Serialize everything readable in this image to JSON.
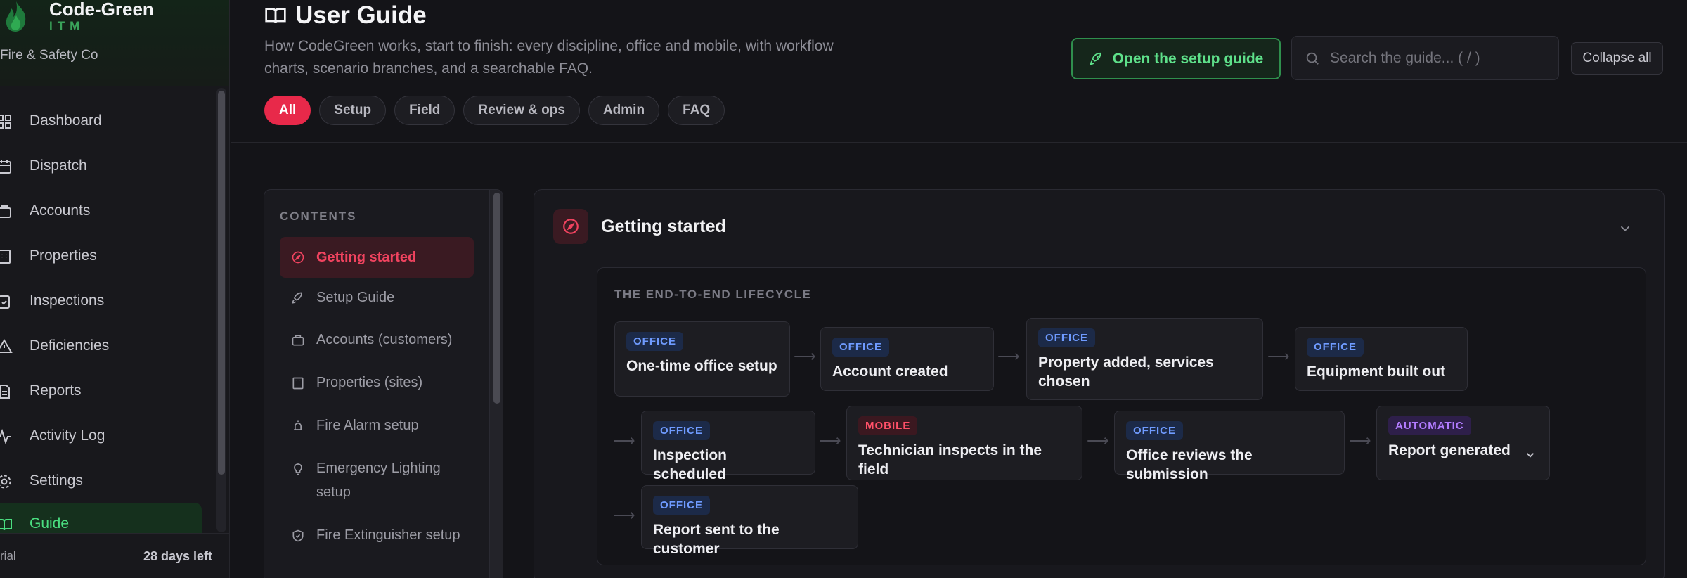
{
  "brand": {
    "name": "Code-Green",
    "sub": "ITM",
    "org": "Fire & Safety Co"
  },
  "nav": [
    {
      "label": "Dashboard",
      "icon": "grid-icon"
    },
    {
      "label": "Dispatch",
      "icon": "calendar-icon"
    },
    {
      "label": "Accounts",
      "icon": "briefcase-icon"
    },
    {
      "label": "Properties",
      "icon": "building-icon"
    },
    {
      "label": "Inspections",
      "icon": "clipboard-check-icon"
    },
    {
      "label": "Deficiencies",
      "icon": "warning-icon"
    },
    {
      "label": "Reports",
      "icon": "document-icon"
    },
    {
      "label": "Activity Log",
      "icon": "pulse-icon"
    },
    {
      "label": "Settings",
      "icon": "gear-icon"
    },
    {
      "label": "Guide",
      "icon": "book-icon",
      "active": true
    }
  ],
  "sidebar_footer": {
    "trial": "rial",
    "days_left": "28 days left"
  },
  "header": {
    "title": "User Guide",
    "subtitle": "How CodeGreen works, start to finish: every discipline, office and mobile, with workflow charts, scenario branches, and a searchable FAQ.",
    "setup_button": "Open the setup guide",
    "search_placeholder": "Search the guide...  ( / )",
    "collapse_button": "Collapse all",
    "filters": [
      "All",
      "Setup",
      "Field",
      "Review & ops",
      "Admin",
      "FAQ"
    ],
    "active_filter": "All"
  },
  "contents": {
    "title": "CONTENTS",
    "items": [
      {
        "label": "Getting started",
        "icon": "compass-icon",
        "active": true
      },
      {
        "label": "Setup Guide",
        "icon": "rocket-icon"
      },
      {
        "label": "Accounts (customers)",
        "icon": "briefcase-icon"
      },
      {
        "label": "Properties (sites)",
        "icon": "building-icon"
      },
      {
        "label": "Fire Alarm setup",
        "icon": "alarm-icon"
      },
      {
        "label": "Emergency Lighting setup",
        "icon": "bulb-icon"
      },
      {
        "label": "Fire Extinguisher setup",
        "icon": "shield-icon"
      }
    ]
  },
  "section": {
    "title": "Getting started",
    "lifecycle_title": "THE END-TO-END LIFECYCLE",
    "steps": [
      {
        "badge": "OFFICE",
        "label": "One-time office setup"
      },
      {
        "badge": "OFFICE",
        "label": "Account created"
      },
      {
        "badge": "OFFICE",
        "label": "Property added, services chosen"
      },
      {
        "badge": "OFFICE",
        "label": "Equipment built out"
      },
      {
        "badge": "OFFICE",
        "label": "Inspection scheduled"
      },
      {
        "badge": "MOBILE",
        "label": "Technician inspects in the field"
      },
      {
        "badge": "OFFICE",
        "label": "Office reviews the submission"
      },
      {
        "badge": "AUTOMATIC",
        "label": "Report generated"
      },
      {
        "badge": "OFFICE",
        "label": "Report sent to the customer"
      }
    ]
  },
  "colors": {
    "accent_red": "#e8294a",
    "accent_green": "#4ade80",
    "office": "#6f9bff",
    "mobile": "#ff5068",
    "automatic": "#b27cff"
  }
}
